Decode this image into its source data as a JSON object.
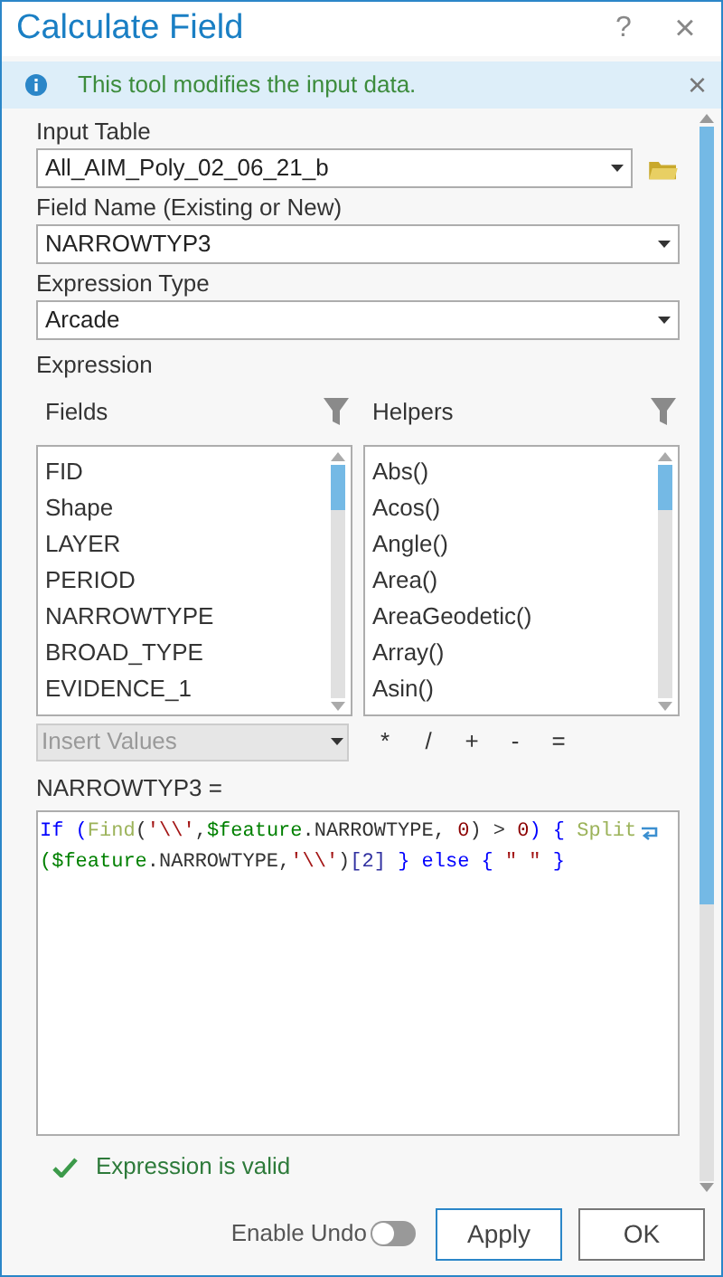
{
  "window": {
    "title": "Calculate Field",
    "help": "?",
    "close": "×"
  },
  "banner": {
    "text": "This tool modifies the input data.",
    "close": "×"
  },
  "input_table": {
    "label": "Input Table",
    "value": "All_AIM_Poly_02_06_21_b"
  },
  "field_name": {
    "label": "Field Name (Existing or New)",
    "value": "NARROWTYP3"
  },
  "expression_type": {
    "label": "Expression Type",
    "value": "Arcade"
  },
  "expression": {
    "label": "Expression",
    "fields": {
      "label": "Fields",
      "items": [
        "FID",
        "Shape",
        "LAYER",
        "PERIOD",
        "NARROWTYPE",
        "BROAD_TYPE",
        "EVIDENCE_1"
      ]
    },
    "helpers": {
      "label": "Helpers",
      "items": [
        "Abs()",
        "Acos()",
        "Angle()",
        "Area()",
        "AreaGeodetic()",
        "Array()",
        "Asin()"
      ]
    },
    "insert_values": {
      "placeholder": "Insert Values",
      "disabled": true
    },
    "operators": [
      "*",
      "/",
      "+",
      "-",
      "="
    ],
    "target_label": "NARROWTYP3 =",
    "code_lines": [
      [
        {
          "kind": "keyword",
          "text": "If ("
        },
        {
          "kind": "function",
          "text": "Find"
        },
        {
          "kind": "plain",
          "text": "("
        },
        {
          "kind": "string",
          "text": "'\\\\'"
        },
        {
          "kind": "plain",
          "text": ","
        },
        {
          "kind": "variable",
          "text": "$feature"
        },
        {
          "kind": "plain",
          "text": ".NARROWTYPE, "
        },
        {
          "kind": "number",
          "text": "0"
        },
        {
          "kind": "plain",
          "text": ") > "
        },
        {
          "kind": "number",
          "text": "0"
        },
        {
          "kind": "keyword",
          "text": ") { "
        },
        {
          "kind": "function",
          "text": "Split"
        }
      ],
      [
        {
          "kind": "variable",
          "text": "($feature"
        },
        {
          "kind": "plain",
          "text": ".NARROWTYPE,"
        },
        {
          "kind": "string",
          "text": "'\\\\'"
        },
        {
          "kind": "plain",
          "text": ")"
        },
        {
          "kind": "index",
          "text": "[2]"
        },
        {
          "kind": "keyword",
          "text": " } else { "
        },
        {
          "kind": "string",
          "text": "\" \""
        },
        {
          "kind": "keyword",
          "text": " }"
        }
      ]
    ],
    "validation": "Expression is valid"
  },
  "footer": {
    "enable_undo": {
      "label": "Enable Undo",
      "on": false
    },
    "buttons": [
      "Apply",
      "OK"
    ]
  }
}
